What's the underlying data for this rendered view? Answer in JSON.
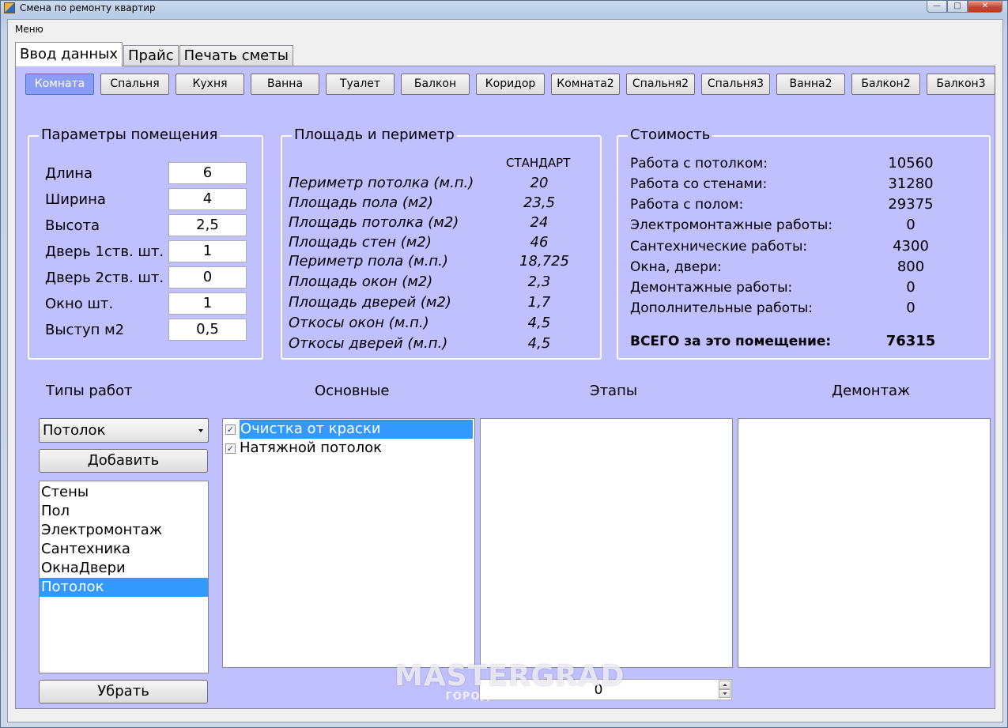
{
  "window": {
    "title": "Смена по ремонту квартир",
    "controls": {
      "minimize": "—",
      "maximize": "□",
      "close": "✕"
    }
  },
  "menu": {
    "label": "Меню"
  },
  "tabs": [
    {
      "label": "Ввод данных",
      "active": true
    },
    {
      "label": "Прайс",
      "active": false
    },
    {
      "label": "Печать сметы",
      "active": false
    }
  ],
  "rooms": [
    "Комната",
    "Спальня",
    "Кухня",
    "Ванна",
    "Туалет",
    "Балкон",
    "Коридор",
    "Комната2",
    "Спальня2",
    "Спальня3",
    "Ванна2",
    "Балкон2",
    "Балкон3"
  ],
  "active_room": "Комната",
  "params": {
    "title": "Параметры помещения",
    "rows": [
      {
        "label": "Длина",
        "value": "6"
      },
      {
        "label": "Ширина",
        "value": "4"
      },
      {
        "label": "Высота",
        "value": "2,5"
      },
      {
        "label": "Дверь 1ств. шт.",
        "value": "1"
      },
      {
        "label": "Дверь 2ств. шт.",
        "value": "0"
      },
      {
        "label": "Окно шт.",
        "value": "1"
      },
      {
        "label": "Выступ м2",
        "value": "0,5"
      }
    ]
  },
  "area": {
    "title": "Площадь и периметр",
    "standard_header": "СТАНДАРТ",
    "rows": [
      {
        "label": "Периметр потолка (м.п.)",
        "value": "20"
      },
      {
        "label": "Площадь пола (м2)",
        "value": "23,5"
      },
      {
        "label": "Площадь потолка (м2)",
        "value": "24"
      },
      {
        "label": "Площадь стен (м2)",
        "value": "46"
      },
      {
        "label": "Периметр пола (м.п.)",
        "value": "18,725"
      },
      {
        "label": "Площадь окон (м2)",
        "value": "2,3"
      },
      {
        "label": "Площадь дверей (м2)",
        "value": "1,7"
      },
      {
        "label": "Откосы окон (м.п.)",
        "value": "4,5"
      },
      {
        "label": "Откосы дверей (м.п.)",
        "value": "4,5"
      }
    ]
  },
  "cost": {
    "title": "Стоимость",
    "rows": [
      {
        "label": "Работа с потолком:",
        "value": "10560"
      },
      {
        "label": "Работа со стенами:",
        "value": "31280"
      },
      {
        "label": "Работа с полом:",
        "value": "29375"
      },
      {
        "label": "Электромонтажные работы:",
        "value": "0"
      },
      {
        "label": "Сантехнические работы:",
        "value": "4300"
      },
      {
        "label": "Окна, двери:",
        "value": "800"
      },
      {
        "label": "Демонтажные работы:",
        "value": "0"
      },
      {
        "label": "Дополнительные работы:",
        "value": "0"
      }
    ],
    "total_label": "ВСЕГО за это помещение:",
    "total_value": "76315"
  },
  "columns": {
    "work_types": "Типы работ",
    "main": "Основные",
    "stages": "Этапы",
    "demolition": "Демонтаж"
  },
  "work_type_combo": {
    "value": "Потолок"
  },
  "add_button": "Добавить",
  "remove_button": "Убрать",
  "work_type_list": {
    "items": [
      "Стены",
      "Пол",
      "Электромонтаж",
      "Сантехника",
      "ОкнаДвери",
      "Потолок"
    ],
    "selected": "Потолок"
  },
  "main_works": [
    {
      "label": "Очистка от краски",
      "checked": true,
      "selected": true
    },
    {
      "label": "Натяжной потолок",
      "checked": true,
      "selected": false
    }
  ],
  "spinner": {
    "value": "0"
  },
  "watermark": {
    "main": "MASTERGRAD",
    "sub": "ГОРОД МАСТЕРОВ"
  },
  "colors": {
    "panel": "#c0c0ff",
    "selection": "#3399ff",
    "active_room": "#8a9cf5"
  }
}
